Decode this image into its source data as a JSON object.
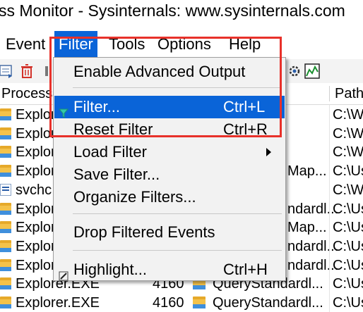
{
  "window": {
    "title": "ss Monitor - Sysinternals: www.sysinternals.com"
  },
  "menubar": {
    "items": [
      {
        "label": "Event"
      },
      {
        "label": "Filter"
      },
      {
        "label": "Tools"
      },
      {
        "label": "Options"
      },
      {
        "label": "Help"
      }
    ]
  },
  "toolbar": {
    "icons": [
      "autoscroll-icon",
      "delete-icon",
      "filter-icon",
      "process-activity-icon",
      "profiling-icon"
    ]
  },
  "columns": {
    "process": "Process",
    "path": "Path"
  },
  "rows": [
    {
      "name": "Explor",
      "pid": "",
      "op": "",
      "path": "C:\\W"
    },
    {
      "name": "Explor",
      "pid": "",
      "op": "",
      "path": "C:\\W"
    },
    {
      "name": "Explor",
      "pid": "",
      "op": "",
      "path": "C:\\W"
    },
    {
      "name": "Explor",
      "pid": "",
      "op": "Map...",
      "path": "C:\\Us"
    },
    {
      "name": "svchc",
      "pid": "",
      "op": "",
      "path": "C:\\W"
    },
    {
      "name": "Explor",
      "pid": "",
      "op": "ndardl...",
      "path": "C:\\Us"
    },
    {
      "name": "Explor",
      "pid": "",
      "op": "Map...",
      "path": "C:\\Us"
    },
    {
      "name": "Explor",
      "pid": "",
      "op": "ndardl...",
      "path": "C:\\Us"
    },
    {
      "name": "Explor",
      "pid": "",
      "op": "ndardl...",
      "path": "C:\\Us"
    },
    {
      "name": "Explorer.EXE",
      "pid": "4160",
      "op": "QueryStandardl...",
      "path": "C:\\Us"
    },
    {
      "name": "Explorer.EXE",
      "pid": "4160",
      "op": "QueryStandardl...",
      "path": "C:\\Us"
    }
  ],
  "filter_menu": {
    "enable_advanced_output": "Enable Advanced Output",
    "filter": "Filter...",
    "filter_shortcut": "Ctrl+L",
    "reset_filter": "Reset Filter",
    "reset_filter_shortcut": "Ctrl+R",
    "load_filter": "Load Filter",
    "save_filter": "Save Filter...",
    "organize_filters": "Organize Filters...",
    "drop_filtered_events": "Drop Filtered Events",
    "highlight": "Highlight...",
    "highlight_shortcut": "Ctrl+H"
  },
  "colors": {
    "highlight": "#0a64d8",
    "annotation": "#e8312a"
  }
}
